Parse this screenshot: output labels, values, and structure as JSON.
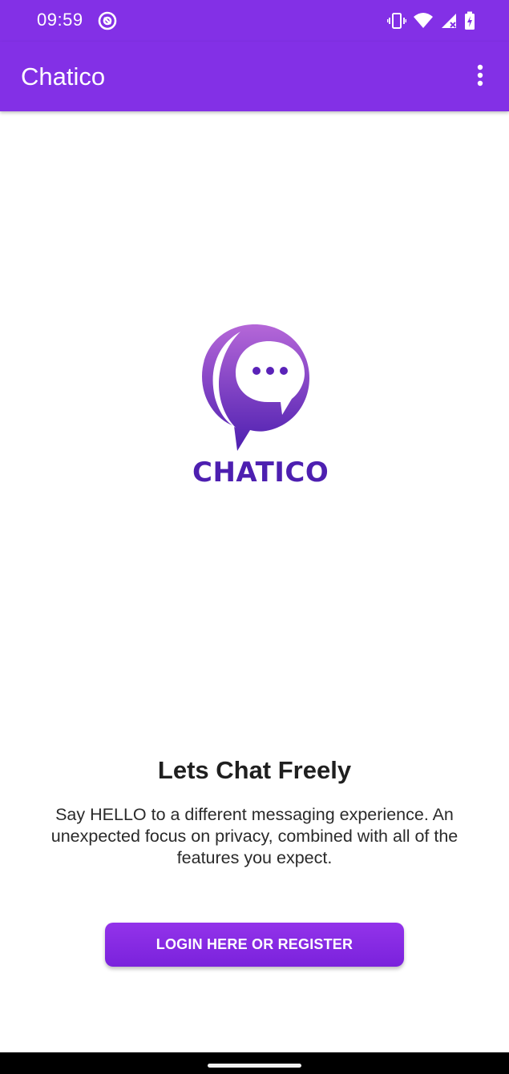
{
  "status_bar": {
    "time": "09:59",
    "icons": [
      "at-sign-icon",
      "vibrate-icon",
      "wifi-icon",
      "cell-signal-icon",
      "battery-charging-icon"
    ]
  },
  "app_bar": {
    "title": "Chatico",
    "menu_icon": "more-vert-icon"
  },
  "logo": {
    "icon": "chat-bubble-logo-icon",
    "wordmark": "CHATICO"
  },
  "main": {
    "headline": "Lets Chat Freely",
    "description": "Say HELLO to a different messaging experience. An unexpected focus on privacy, combined with all of the features you expect."
  },
  "actions": {
    "login_label": "LOGIN HERE OR REGISTER"
  },
  "colors": {
    "primary": "#8330e6",
    "logo_dark": "#4d1fb0",
    "logo_light": "#b567d8"
  }
}
